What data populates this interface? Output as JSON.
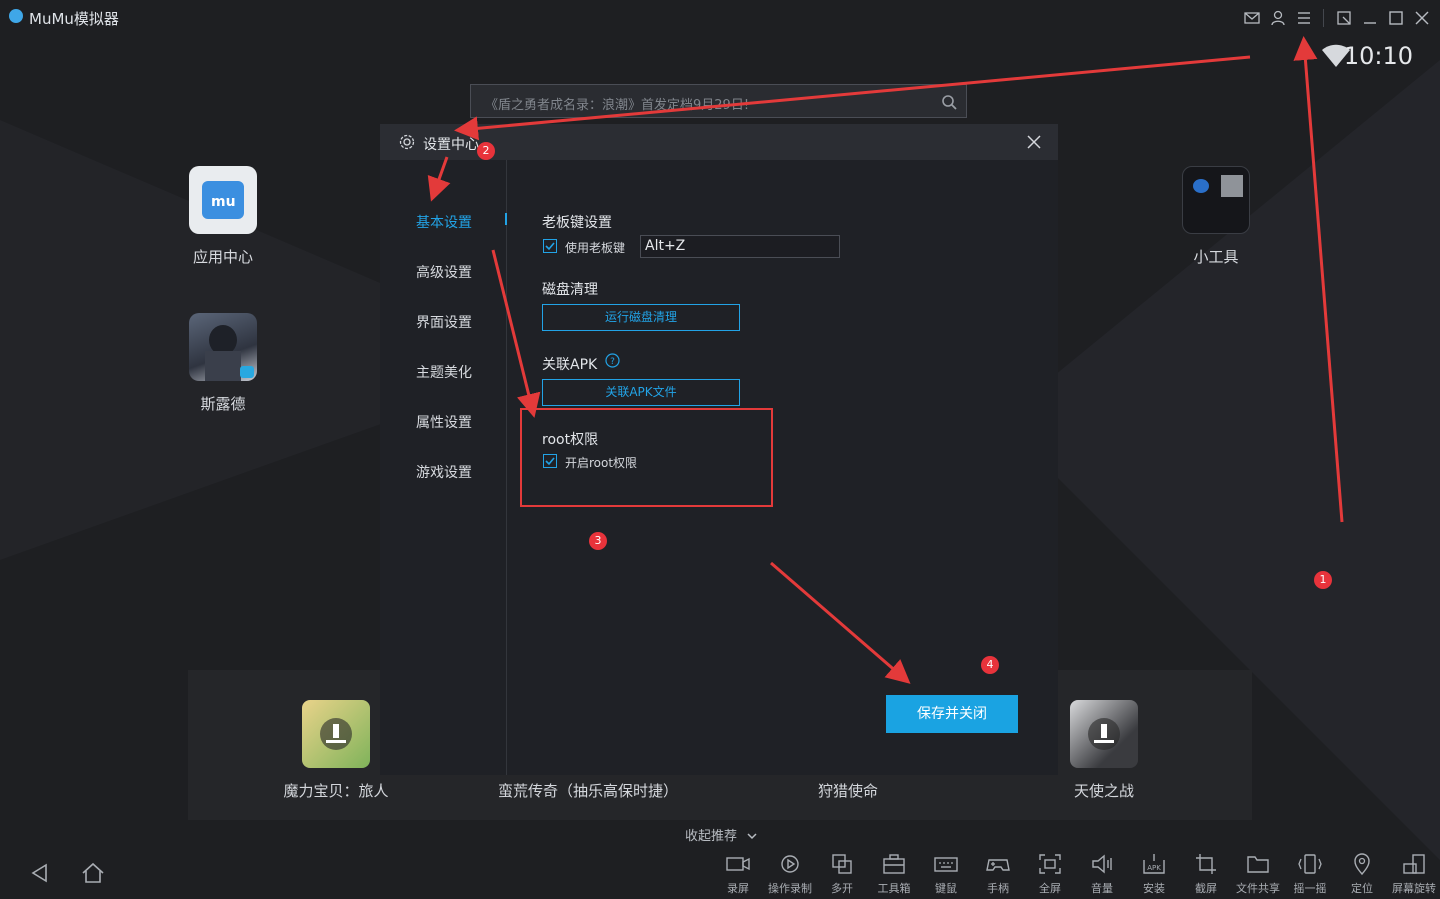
{
  "window": {
    "title": "MuMu模拟器"
  },
  "status": {
    "time": "10:10"
  },
  "search": {
    "text": "《盾之勇者成名录：浪潮》首发定档9月29日!"
  },
  "desktop_apps": [
    {
      "label": "应用中心"
    },
    {
      "label": "斯露德"
    },
    {
      "label": "小工具"
    }
  ],
  "dialog": {
    "title": "设置中心",
    "nav": [
      "基本设置",
      "高级设置",
      "界面设置",
      "主题美化",
      "属性设置",
      "游戏设置"
    ],
    "active_nav": "基本设置",
    "boss_key": {
      "title": "老板键设置",
      "checkbox_label": "使用老板键",
      "checked": true,
      "value": "Alt+Z"
    },
    "disk": {
      "title": "磁盘清理",
      "button": "运行磁盘清理"
    },
    "apk": {
      "title": "关联APK",
      "button": "关联APK文件"
    },
    "root": {
      "title": "root权限",
      "checkbox_label": "开启root权限",
      "checked": true
    },
    "save_button": "保存并关闭"
  },
  "recommend": {
    "items": [
      "魔力宝贝：旅人",
      "蛮荒传奇（抽乐高保时捷）",
      "狩猎使命",
      "天使之战"
    ],
    "collapse_label": "收起推荐"
  },
  "toolbar": [
    "录屏",
    "操作录制",
    "多开",
    "工具箱",
    "键鼠",
    "手柄",
    "全屏",
    "音量",
    "安装",
    "截屏",
    "文件共享",
    "摇一摇",
    "定位",
    "屏幕旋转"
  ],
  "annotations": [
    "1",
    "2",
    "3",
    "4"
  ],
  "colors": {
    "accent": "#22a3e6",
    "annotation": "#e8333b",
    "background": "#1e1f22"
  }
}
